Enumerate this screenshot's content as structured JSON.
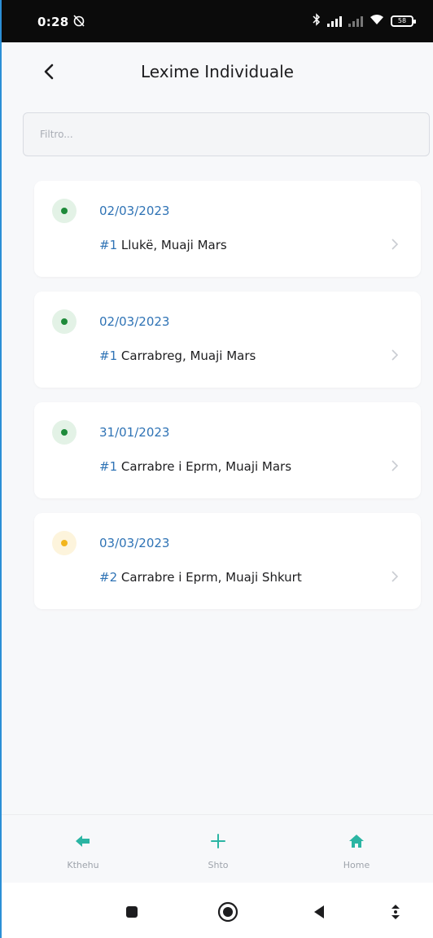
{
  "status_bar": {
    "time": "0:28",
    "battery": "58"
  },
  "header": {
    "title": "Lexime Individuale"
  },
  "filter": {
    "placeholder": "Filtro...",
    "value": ""
  },
  "list": {
    "items": [
      {
        "status_color": "#1e8a3a",
        "status_bg": "#e3f2e6",
        "date": "02/03/2023",
        "number": "#1",
        "description": "Llukë, Muaji Mars"
      },
      {
        "status_color": "#1e8a3a",
        "status_bg": "#e3f2e6",
        "date": "02/03/2023",
        "number": "#1",
        "description": "Carrabreg, Muaji Mars"
      },
      {
        "status_color": "#1e8a3a",
        "status_bg": "#e3f2e6",
        "date": "31/01/2023",
        "number": "#1",
        "description": "Carrabre i Eprm, Muaji Mars"
      },
      {
        "status_color": "#f2b51c",
        "status_bg": "#fdf4dc",
        "date": "03/03/2023",
        "number": "#2",
        "description": "Carrabre i Eprm, Muaji Shkurt"
      }
    ]
  },
  "bottom_nav": {
    "accent": "#2bb5a3",
    "items": [
      {
        "label": "Kthehu",
        "icon": "arrow-left-icon"
      },
      {
        "label": "Shto",
        "icon": "plus-icon"
      },
      {
        "label": "Home",
        "icon": "home-icon"
      }
    ]
  },
  "system_nav": {
    "items": [
      "recents-icon",
      "home-circle-icon",
      "back-triangle-icon",
      "more-icon"
    ]
  }
}
